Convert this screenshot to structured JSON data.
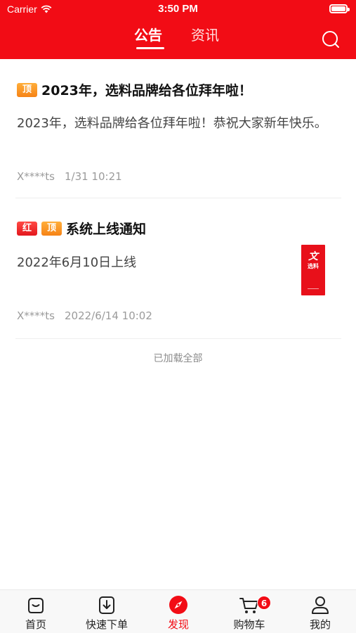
{
  "status_bar": {
    "carrier": "Carrier",
    "time": "3:50 PM"
  },
  "header": {
    "tabs": [
      {
        "label": "公告",
        "active": true
      },
      {
        "label": "资讯",
        "active": false
      }
    ],
    "search_icon": "search-icon"
  },
  "posts": [
    {
      "tags": [
        "顶"
      ],
      "title": "2023年，选料品牌给各位拜年啦！",
      "body": "2023年，选料品牌给各位拜年啦！恭祝大家新年快乐。",
      "author": "X****ts",
      "date": "1/31 10:21"
    },
    {
      "tags": [
        "红",
        "顶"
      ],
      "title": "系统上线通知",
      "body": "2022年6月10日上线",
      "author": "X****ts",
      "date": "2022/6/14 10:02",
      "thumbnail_text": "选料"
    }
  ],
  "list_footer": "已加载全部",
  "tabbar": {
    "items": [
      {
        "label": "首页",
        "icon": "home-icon"
      },
      {
        "label": "快速下单",
        "icon": "quick-order-icon"
      },
      {
        "label": "发现",
        "icon": "compass-icon",
        "active": true
      },
      {
        "label": "购物车",
        "icon": "cart-icon",
        "badge": "6"
      },
      {
        "label": "我的",
        "icon": "profile-icon"
      }
    ]
  },
  "colors": {
    "brand_red": "#f20c15",
    "tag_orange": "#f68316"
  }
}
